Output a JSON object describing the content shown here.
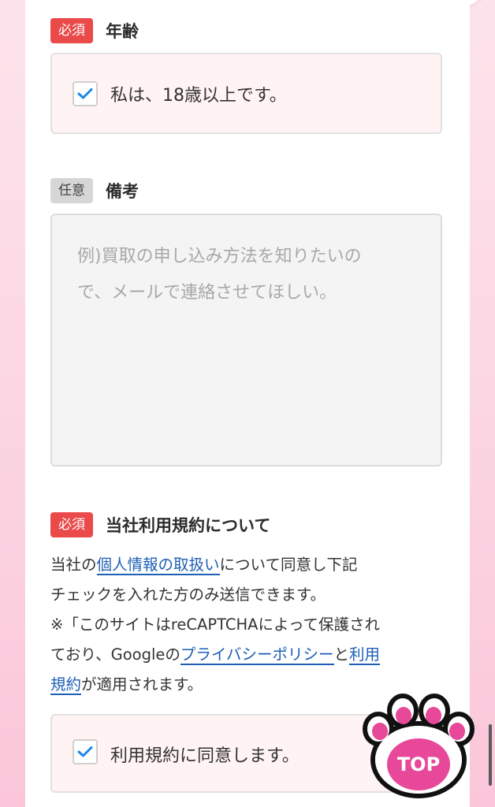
{
  "age": {
    "badge": "必須",
    "label": "年齢",
    "checkbox_label": "私は、18歳以上です。",
    "checked": true
  },
  "remarks": {
    "badge": "任意",
    "label": "備考",
    "placeholder_line1": "例)買取の申し込み方法を知りたいの",
    "placeholder_line2": "で、メールで連絡させてほしい。"
  },
  "terms": {
    "badge": "必須",
    "label": "当社利用規約について",
    "line1_pre": "当社の",
    "privacy_link": "個人情報の取扱い",
    "line1_post": "について同意し下記",
    "line2": "チェックを入れた方のみ送信できます。",
    "line3": "※「このサイトはreCAPTCHAによって保護され",
    "line4_pre": "ており、Googleの",
    "google_privacy_link": "プライバシーポリシー",
    "line4_mid": "と",
    "terms_link_a": "利用",
    "terms_link_b": "規約",
    "line5_post": "が適用されます。",
    "checkbox_label": "利用規約に同意します。",
    "checked": true
  },
  "top_button": {
    "label": "TOP"
  },
  "colors": {
    "accent_required": "#ea4a4a",
    "link": "#1e5fb4",
    "check": "#1a86e8",
    "paw": "#e8489a"
  }
}
